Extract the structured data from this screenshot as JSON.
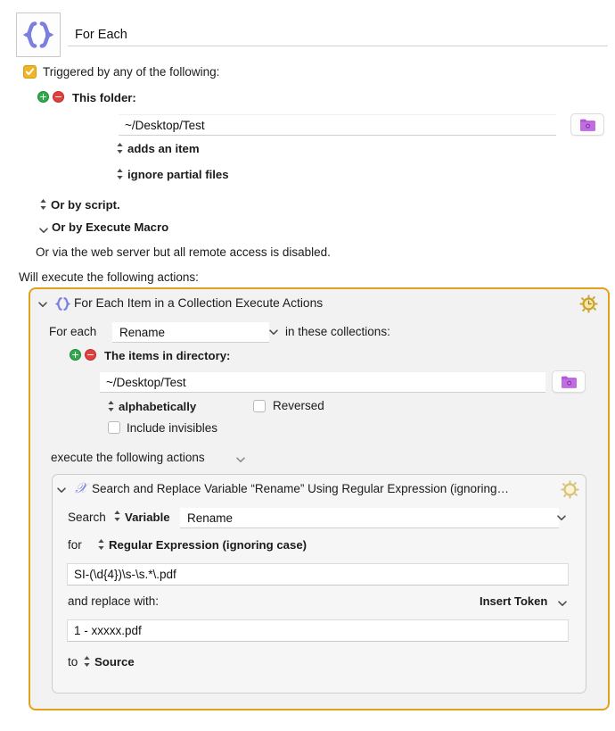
{
  "macro": {
    "icon": "curly-braces-icon",
    "name": "For Each"
  },
  "trigger": {
    "checkbox_checked": true,
    "label": "Triggered by any of the following:",
    "folder_trigger": {
      "label": "This folder:",
      "path": "~/Desktop/Test",
      "path_placeholder": "",
      "event": "adds an item",
      "partial": "ignore partial files",
      "folder_button_icon": "folder-icon"
    },
    "or_by_script": "Or by script.",
    "or_by_execute_macro": "Or by Execute Macro",
    "web_server_note": "Or via the web server but all remote access is disabled."
  },
  "actions_header": "Will execute the following actions:",
  "for_each_action": {
    "title": "For Each Item in a Collection Execute Actions",
    "icon": "curly-braces-icon",
    "gear_icon": "gear-clock-icon",
    "disclosure_icon": "chevron-down-icon",
    "for_each_label": "For each",
    "variable": "Rename",
    "in_collections_label": "in these collections:",
    "collection": {
      "label": "The items in directory:",
      "path": "~/Desktop/Test",
      "sort_order": "alphabetically",
      "reversed_label": "Reversed",
      "reversed_checked": false,
      "include_invisibles_label": "Include invisibles",
      "include_invisibles_checked": false,
      "folder_button_icon": "folder-icon"
    },
    "execute_label": "execute the following actions"
  },
  "search_replace_action": {
    "title": "Search and Replace Variable “Rename” Using Regular Expression (ignoring…",
    "icon": "script-x-icon",
    "gear_icon": "gear-icon",
    "disclosure_icon": "chevron-down-icon",
    "search_label": "Search",
    "search_target": "Variable",
    "variable_name": "Rename",
    "for_label": "for",
    "match_mode": "Regular Expression (ignoring case)",
    "pattern": "SI-(\\d{4})\\s-\\s.*\\.pdf",
    "replace_label": "and replace with:",
    "insert_token_label": "Insert Token",
    "replacement": "1 - xxxxx.pdf",
    "to_label": "to",
    "destination": "Source"
  },
  "colors": {
    "accent_orange": "#e0a21b",
    "checkbox_gold": "#f0b429",
    "icon_purple": "#7b7fe0",
    "folder_purple": "#b255d8",
    "add_green": "#2faa4b",
    "remove_red": "#e0403c"
  }
}
